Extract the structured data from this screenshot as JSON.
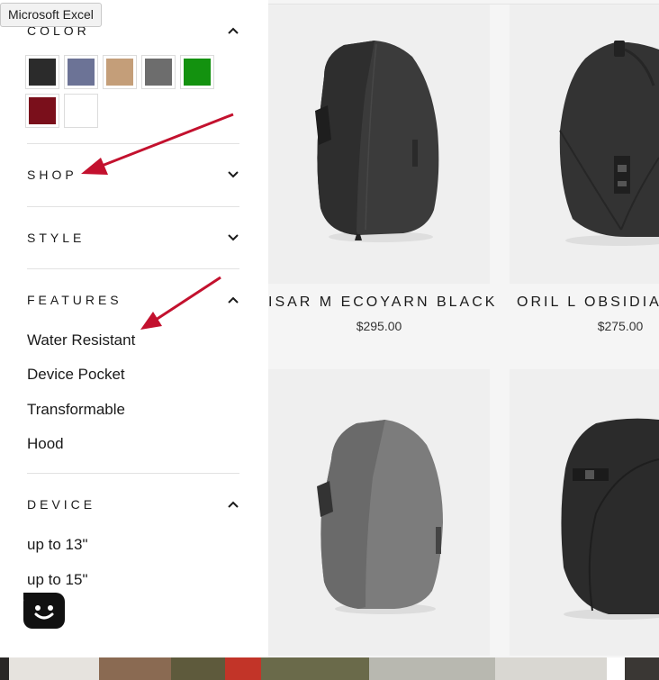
{
  "tooltip": {
    "text": "Microsoft Excel"
  },
  "filters": {
    "color": {
      "title": "COLOR",
      "expanded": true,
      "swatches": [
        {
          "name": "black",
          "color": "#2b2b2b"
        },
        {
          "name": "blue",
          "color": "#6c7396"
        },
        {
          "name": "tan",
          "color": "#c49e79"
        },
        {
          "name": "grey",
          "color": "#6d6d6d"
        },
        {
          "name": "green",
          "color": "#13920f"
        },
        {
          "name": "burgundy",
          "color": "#7a0f1b"
        },
        {
          "name": "white",
          "color": "#ffffff"
        }
      ]
    },
    "shop": {
      "title": "SHOP",
      "expanded": false
    },
    "style": {
      "title": "STYLE",
      "expanded": false
    },
    "features": {
      "title": "FEATURES",
      "expanded": true,
      "options": [
        "Water Resistant",
        "Device Pocket",
        "Transformable",
        "Hood"
      ]
    },
    "device": {
      "title": "DEVICE",
      "expanded": true,
      "options": [
        "up to 13\"",
        "up to 15\""
      ]
    }
  },
  "products": [
    {
      "name": "ISAR M ECOYARN BLACK",
      "price": "$295.00"
    },
    {
      "name": "ORIL L OBSIDIAN",
      "price": "$275.00"
    },
    {
      "name": "",
      "price": ""
    },
    {
      "name": "",
      "price": ""
    }
  ],
  "annotation_color": "#c3112e"
}
